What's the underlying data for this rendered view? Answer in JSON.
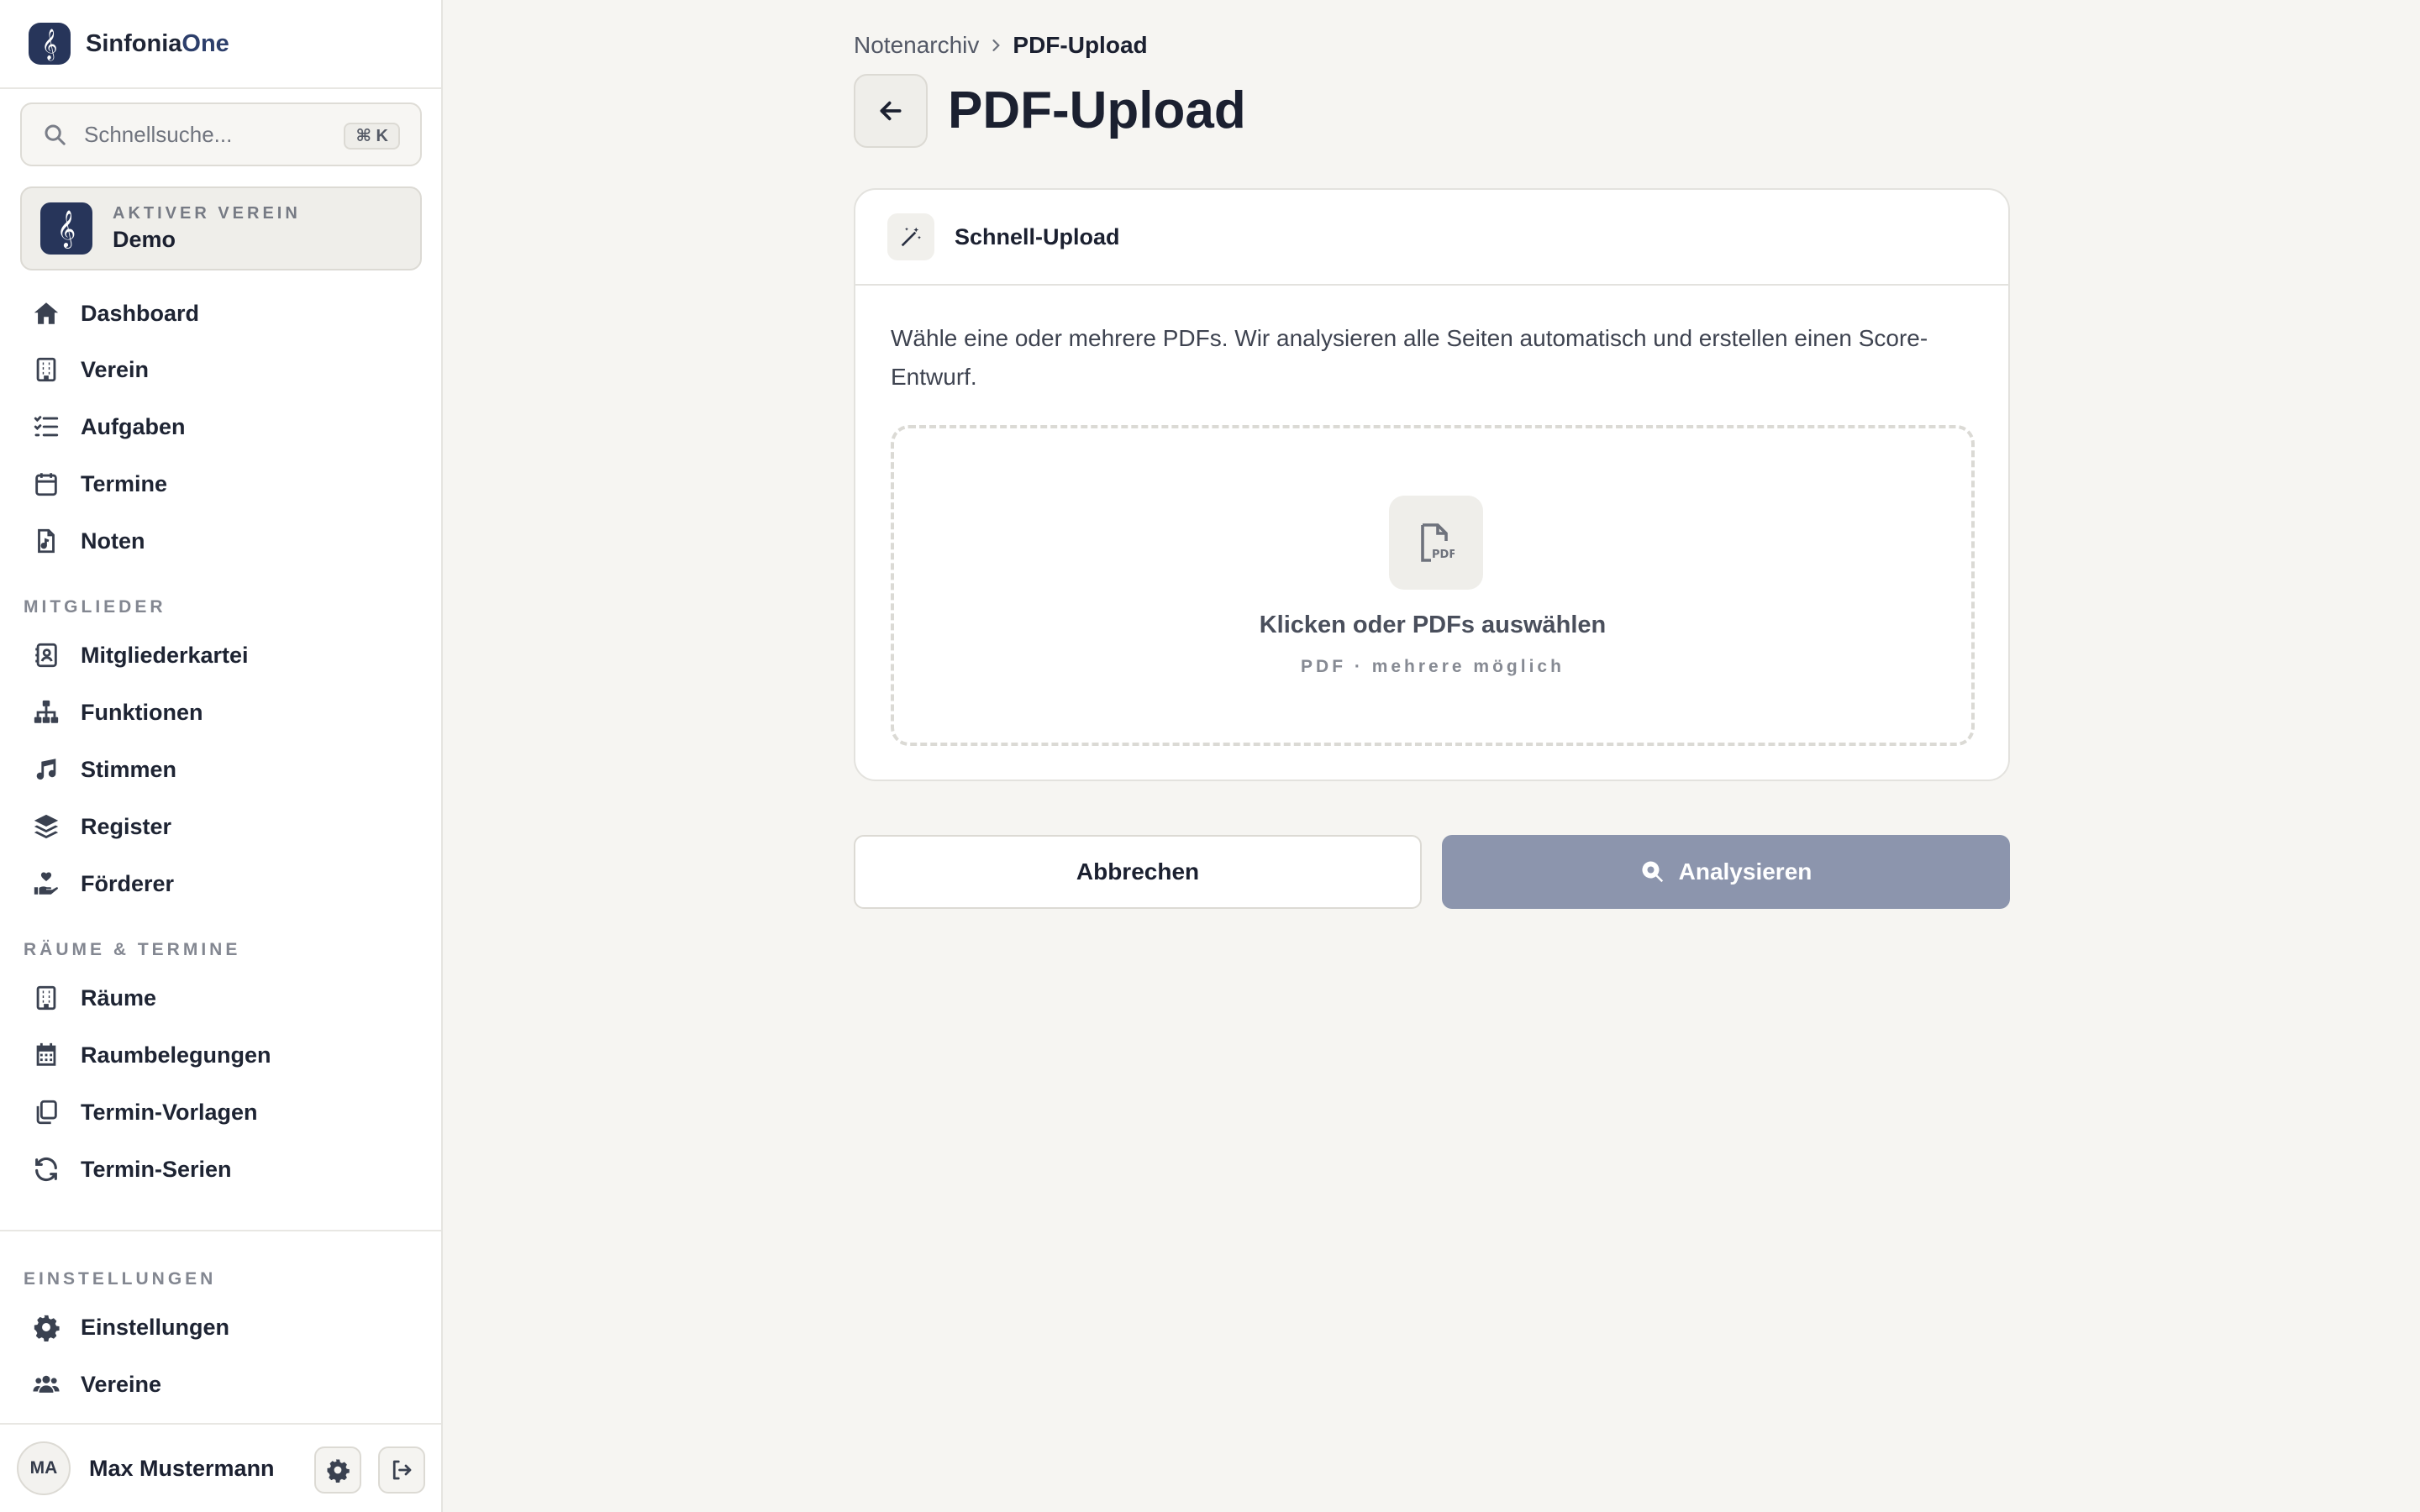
{
  "brand": {
    "name_main": "Sinfonia",
    "name_accent": "One",
    "logo_glyph": "𝄞"
  },
  "search": {
    "placeholder": "Schnellsuche...",
    "shortcut": "⌘ K"
  },
  "active_club": {
    "label": "AKTIVER VEREIN",
    "name": "Demo",
    "logo_glyph": "𝄞"
  },
  "nav": {
    "main": [
      {
        "label": "Dashboard",
        "icon": "home-icon"
      },
      {
        "label": "Verein",
        "icon": "building-icon"
      },
      {
        "label": "Aufgaben",
        "icon": "list-check-icon"
      },
      {
        "label": "Termine",
        "icon": "calendar-icon"
      },
      {
        "label": "Noten",
        "icon": "music-file-icon"
      }
    ],
    "sections": [
      {
        "title": "MITGLIEDER",
        "items": [
          {
            "label": "Mitgliederkartei",
            "icon": "address-card-icon"
          },
          {
            "label": "Funktionen",
            "icon": "sitemap-icon"
          },
          {
            "label": "Stimmen",
            "icon": "music-note-icon"
          },
          {
            "label": "Register",
            "icon": "layers-icon"
          },
          {
            "label": "Förderer",
            "icon": "hand-holding-heart-icon"
          }
        ]
      },
      {
        "title": "RÄUME & TERMINE",
        "items": [
          {
            "label": "Räume",
            "icon": "building-icon"
          },
          {
            "label": "Raumbelegungen",
            "icon": "calendar-grid-icon"
          },
          {
            "label": "Termin-Vorlagen",
            "icon": "copy-icon"
          },
          {
            "label": "Termin-Serien",
            "icon": "refresh-icon"
          }
        ]
      },
      {
        "title": "EINSTELLUNGEN",
        "items": [
          {
            "label": "Einstellungen",
            "icon": "gear-icon"
          },
          {
            "label": "Vereine",
            "icon": "users-icon"
          }
        ]
      }
    ]
  },
  "user": {
    "initials": "MA",
    "name": "Max Mustermann"
  },
  "breadcrumb": {
    "parent": "Notenarchiv",
    "current": "PDF-Upload"
  },
  "page": {
    "title": "PDF-Upload"
  },
  "upload_card": {
    "title": "Schnell-Upload",
    "description": "Wähle eine oder mehrere PDFs. Wir analysieren alle Seiten automatisch und erstellen einen Score-Entwurf.",
    "dropzone_title": "Klicken oder PDFs auswählen",
    "dropzone_subtitle": "PDF · mehrere möglich",
    "pdf_icon_text": "PDF"
  },
  "actions": {
    "cancel_label": "Abbrechen",
    "analyze_label": "Analysieren",
    "analyze_disabled": true
  },
  "colors": {
    "brand": "#27355a",
    "analyze_disabled_bg": "#8c95ad",
    "background": "#f6f5f2"
  }
}
